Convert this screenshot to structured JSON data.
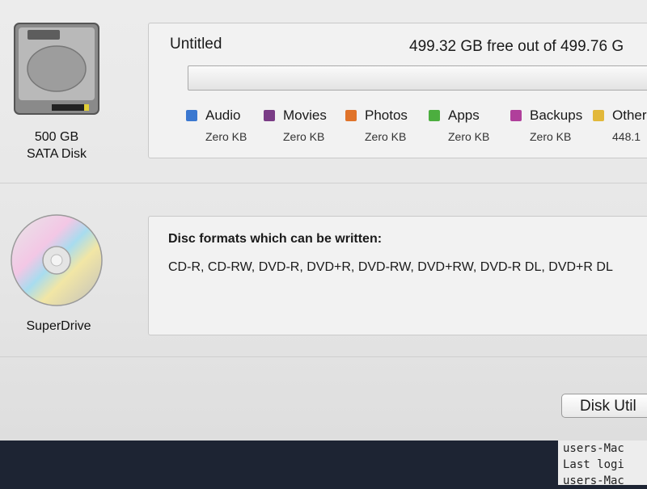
{
  "disk": {
    "capacity_line1": "500 GB",
    "capacity_line2": "SATA Disk",
    "volume_name": "Untitled",
    "free_space": "499.32 GB free out of 499.76 G",
    "legend": [
      {
        "name": "Audio",
        "size": "Zero KB",
        "color": "#3b78d0"
      },
      {
        "name": "Movies",
        "size": "Zero KB",
        "color": "#7a3c86"
      },
      {
        "name": "Photos",
        "size": "Zero KB",
        "color": "#e0732a"
      },
      {
        "name": "Apps",
        "size": "Zero KB",
        "color": "#4cae3f"
      },
      {
        "name": "Backups",
        "size": "Zero KB",
        "color": "#b03f9b"
      },
      {
        "name": "Other",
        "size": "448.1",
        "color": "#e2b83a"
      }
    ]
  },
  "drive": {
    "label": "SuperDrive",
    "formats_title": "Disc formats which can be written:",
    "formats_list": "CD-R, CD-RW, DVD-R, DVD+R, DVD-RW, DVD+RW, DVD-R DL, DVD+R DL"
  },
  "buttons": {
    "disk_utility": "Disk Util"
  },
  "terminal": {
    "lines": [
      "users-Mac",
      "Last logi",
      "users-Mac"
    ]
  },
  "icons": {
    "hdd": "hard-disk-icon",
    "cd": "cd-disc-icon"
  }
}
